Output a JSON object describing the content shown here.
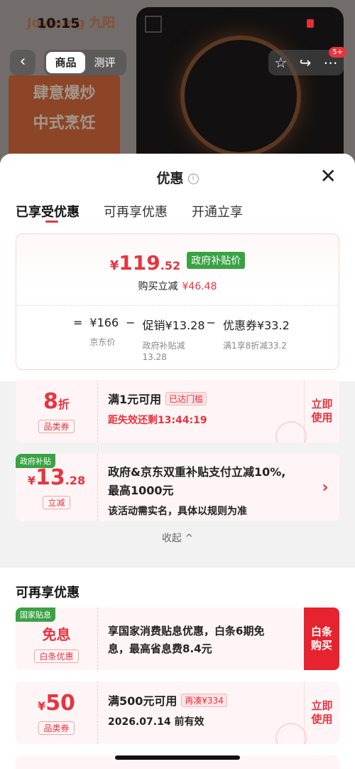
{
  "status_bar": {
    "time": "10:15"
  },
  "background": {
    "brand_text": "Joyoung 九阳",
    "banner_text": [
      "肆意爆炒",
      "中式烹饪"
    ],
    "nav_tabs": [
      "商品",
      "测评"
    ],
    "message_badge": "5+"
  },
  "sheet": {
    "title": "优惠",
    "tabs": [
      "已享受优惠",
      "可再享优惠",
      "开通立享"
    ],
    "price": {
      "currency": "¥",
      "integer": "119",
      "decimal": ".52",
      "tag": "政府补贴价",
      "reduce_label": "购买立减",
      "reduce_value": "¥46.48"
    },
    "calc": {
      "eq": "=",
      "op": "−",
      "base": "¥166",
      "base_label": "京东价",
      "promo": "促销¥13.28",
      "promo_label": "政府补贴减13.28",
      "coupon": "优惠券¥33.2",
      "coupon_label": "满1享8折减33.2"
    },
    "coupons": [
      {
        "value": "8",
        "unit": "折",
        "tag": "品类券",
        "line1": "满1元可用",
        "reach": "已达门槛",
        "line2": "距失效还剩13:44:19",
        "action": "立即使用"
      },
      {
        "corner": "政府补贴",
        "currency": "¥",
        "value": "13",
        "decimal": ".28",
        "tag": "立减",
        "line1": "政府&京东双重补贴支付立减10%,",
        "line1b": "最高1000元",
        "line2": "该活动需实名，具体以规则为准",
        "chevron": "›"
      }
    ],
    "collapse_label": "收起 ^",
    "section2_title": "可再享优惠",
    "coupons2": [
      {
        "corner": "国家贴息",
        "value": "免息",
        "tag": "白条优惠",
        "line1": "享国家消费贴息优惠，白条6期免",
        "line1b": "息，最高省息费8.4元",
        "action": "白条购买"
      },
      {
        "currency": "¥",
        "value": "50",
        "tag": "品类券",
        "line1": "满500元可用",
        "reach": "再凑¥334",
        "line2": "2026.07.14 前有效",
        "action": "立即使用"
      }
    ]
  }
}
